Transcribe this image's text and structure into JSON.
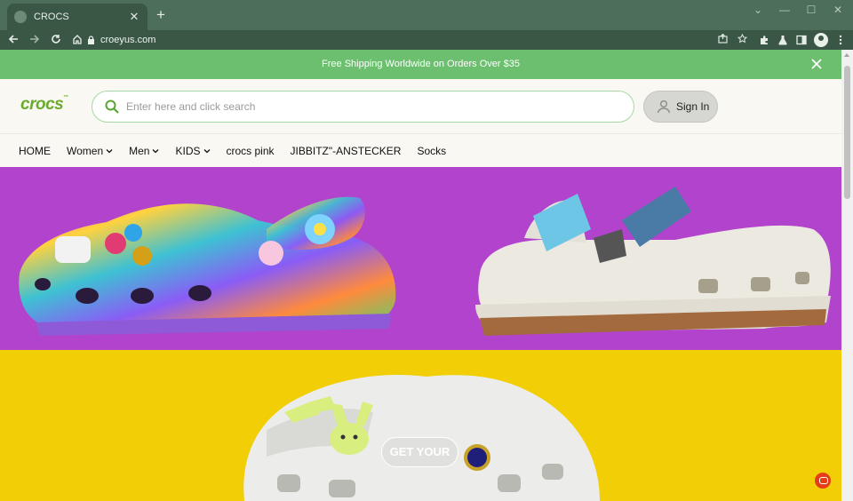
{
  "browser": {
    "tab_title": "CROCS",
    "tab_close": "✕",
    "new_tab": "+",
    "url": "croeyus.com",
    "window_controls": [
      "⌄",
      "—",
      "☐",
      "✕"
    ]
  },
  "promo": {
    "text": "Free Shipping Worldwide on Orders Over $35"
  },
  "header": {
    "logo": "crocs",
    "logo_tm": "™",
    "search_placeholder": "Enter here and click search",
    "sign_in": "Sign In"
  },
  "nav": {
    "items": [
      {
        "label": "HOME",
        "has_dropdown": false
      },
      {
        "label": "Women",
        "has_dropdown": true
      },
      {
        "label": "Men",
        "has_dropdown": true
      },
      {
        "label": "KIDS",
        "has_dropdown": true
      },
      {
        "label": "crocs pink",
        "has_dropdown": false
      },
      {
        "label": "JIBBITZ\"-ANSTECKER",
        "has_dropdown": false
      },
      {
        "label": "Socks",
        "has_dropdown": false
      }
    ]
  },
  "hero": {
    "banner1_color": "#b243cc",
    "banner2_color": "#f1ce05",
    "cta": "GET YOUR"
  },
  "colors": {
    "brand_green": "#6aab2e",
    "promo_green": "#6cbf6f",
    "chat_red": "#e53d17"
  }
}
